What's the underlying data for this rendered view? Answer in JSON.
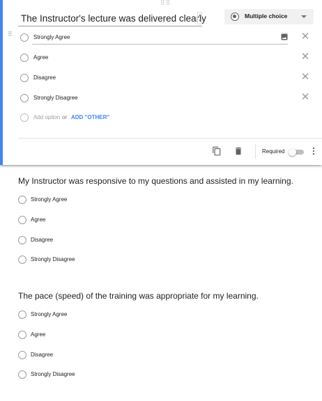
{
  "active_question": {
    "title": "The Instructor's lecture was delivered clearly",
    "type_label": "Multiple choice",
    "options": [
      "Strongly Agree",
      "Agree",
      "Disagree",
      "Strongly Disagree"
    ],
    "add_option": "Add option",
    "add_or": "or",
    "add_other": "ADD \"OTHER\"",
    "required_label": "Required",
    "required": false
  },
  "questions": [
    {
      "title": "My Instructor was responsive to my questions and assisted in my learning.",
      "options": [
        "Strongly Agree",
        "Agree",
        "Disagree",
        "Strongly Disagree"
      ]
    },
    {
      "title": "The pace (speed) of the training was appropriate for my learning.",
      "options": [
        "Strongly Agree",
        "Agree",
        "Disagree",
        "Strongly Disagree"
      ]
    }
  ],
  "colors": {
    "accent": "#4285f4",
    "icon": "#5f6368"
  }
}
